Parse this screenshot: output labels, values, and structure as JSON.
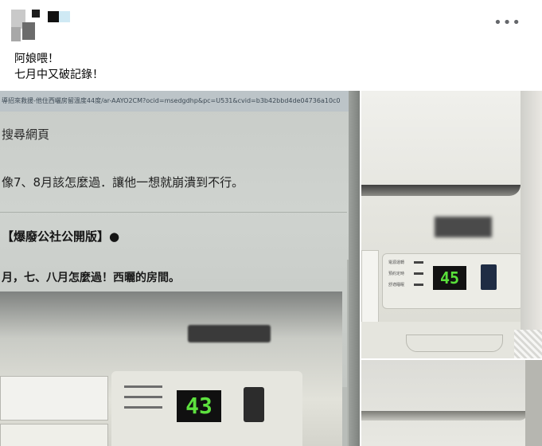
{
  "post": {
    "more_menu": "•••",
    "text_lines": [
      "阿娘喂！",
      "七月中又破記錄！"
    ]
  },
  "photo_main": {
    "url_text": "導招來救援-他住西曬房留溫度44度/ar-AAYO2CM?ocid=msedgdhp&pc=U531&cvid=b3b42bbd4de04736a10c0",
    "line1": "搜尋網頁",
    "line2": "像7、8月該怎麼過．讓他一想就崩潰到不行。",
    "line3": "【爆廢公社公開版】●",
    "line4": "月，七、八月怎麼過！西曬的房間。",
    "display_value": "43"
  },
  "photo_top_right": {
    "display_value": "45",
    "indicator_labels": [
      "電源運轉",
      "預約定時",
      "舒適睡眠"
    ]
  }
}
